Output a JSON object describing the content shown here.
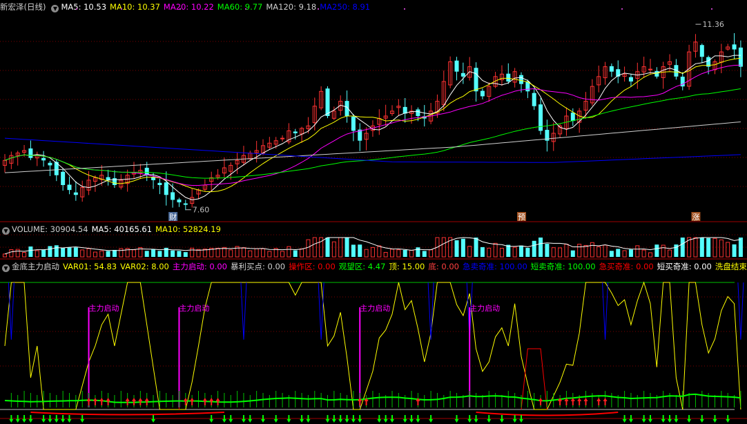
{
  "price_panel": {
    "stock_name": "新宏泽(日线)",
    "ma_labels": [
      {
        "text": "MA5: 10.53",
        "color": "#ffffff"
      },
      {
        "text": "MA10: 10.37",
        "color": "#ffff00"
      },
      {
        "text": "MA20: 10.22",
        "color": "#ff00ff"
      },
      {
        "text": "MA60: 9.77",
        "color": "#00ff00"
      },
      {
        "text": "MA120: 9.18",
        "color": "#d0d0d0"
      },
      {
        "text": "MA250: 8.91",
        "color": "#0000ff"
      }
    ],
    "high_annotation": "11.36",
    "low_annotation": "7.60",
    "event_tags": [
      "财",
      "预",
      "涨"
    ]
  },
  "volume_panel": {
    "labels": [
      {
        "text": "VOLUME: 30904.54",
        "color": "#d0d0d0"
      },
      {
        "text": "MA5: 40165.61",
        "color": "#ffffff"
      },
      {
        "text": "MA10: 52824.19",
        "color": "#ffff00"
      }
    ]
  },
  "indicator_panel": {
    "labels": [
      {
        "text": "金底主力启动",
        "color": "#d0d0d0"
      },
      {
        "text": "VAR01: 54.83",
        "color": "#ffff00"
      },
      {
        "text": "VAR02: 8.00",
        "color": "#ffff00"
      },
      {
        "text": "主力启动: 0.00",
        "color": "#ff00ff"
      },
      {
        "text": "暴利买点: 0.00",
        "color": "#d0d0d0"
      },
      {
        "text": "操作区: 0.00",
        "color": "#ff0000"
      },
      {
        "text": "观望区: 4.47",
        "color": "#00ff00"
      },
      {
        "text": "顶: 15.00",
        "color": "#ffff00"
      },
      {
        "text": "底: 0.00",
        "color": "#ff4040"
      },
      {
        "text": "急卖奇准: 100.00",
        "color": "#0000ff"
      },
      {
        "text": "短卖奇准: 100.00",
        "color": "#00ff00"
      },
      {
        "text": "急买奇准: 0.00",
        "color": "#ff0000"
      },
      {
        "text": "短买奇准: 0.00",
        "color": "#ffffff"
      },
      {
        "text": "洗盘结束:",
        "color": "#ffff00"
      }
    ],
    "signal_label": "主力启动"
  },
  "colors": {
    "up": "#ff3232",
    "down": "#54ffff",
    "ma5": "#ffffff",
    "ma10": "#ffff00",
    "ma20": "#ff00ff",
    "ma60": "#00ff00",
    "ma120": "#d0d0d0",
    "ma250": "#0000ff",
    "grid": "#800000"
  },
  "chart_data": {
    "type": "candlestick",
    "title": "新宏泽(日线)",
    "price_range": [
      7.4,
      11.6
    ],
    "period_high": 11.36,
    "period_low": 7.6,
    "closes": [
      8.6,
      8.7,
      8.75,
      8.8,
      8.65,
      8.7,
      8.6,
      8.5,
      8.3,
      8.1,
      8.0,
      7.9,
      8.05,
      8.2,
      8.25,
      8.3,
      8.2,
      8.1,
      8.2,
      8.3,
      8.35,
      8.4,
      8.3,
      8.2,
      8.1,
      7.9,
      7.8,
      7.75,
      7.7,
      7.85,
      8.0,
      8.1,
      8.25,
      8.3,
      8.45,
      8.5,
      8.6,
      8.7,
      8.75,
      8.8,
      8.9,
      8.95,
      9.0,
      9.05,
      9.2,
      9.15,
      9.25,
      9.3,
      9.7,
      10.0,
      9.5,
      9.6,
      9.8,
      9.5,
      9.2,
      9.0,
      9.15,
      9.3,
      9.45,
      9.5,
      9.6,
      9.7,
      9.55,
      9.6,
      9.5,
      9.45,
      9.6,
      9.8,
      10.2,
      10.6,
      10.4,
      10.3,
      10.5,
      10.0,
      9.9,
      10.1,
      10.3,
      10.35,
      10.2,
      10.4,
      10.15,
      10.0,
      9.7,
      9.2,
      9.0,
      9.15,
      9.3,
      9.5,
      9.4,
      9.6,
      9.8,
      10.1,
      10.3,
      10.5,
      10.4,
      10.3,
      10.35,
      10.2,
      10.4,
      10.5,
      10.45,
      10.3,
      10.5,
      10.6,
      10.3,
      10.1,
      10.8,
      11.0,
      10.7,
      10.5,
      10.6,
      10.8,
      10.9,
      10.85,
      10.5
    ]
  }
}
